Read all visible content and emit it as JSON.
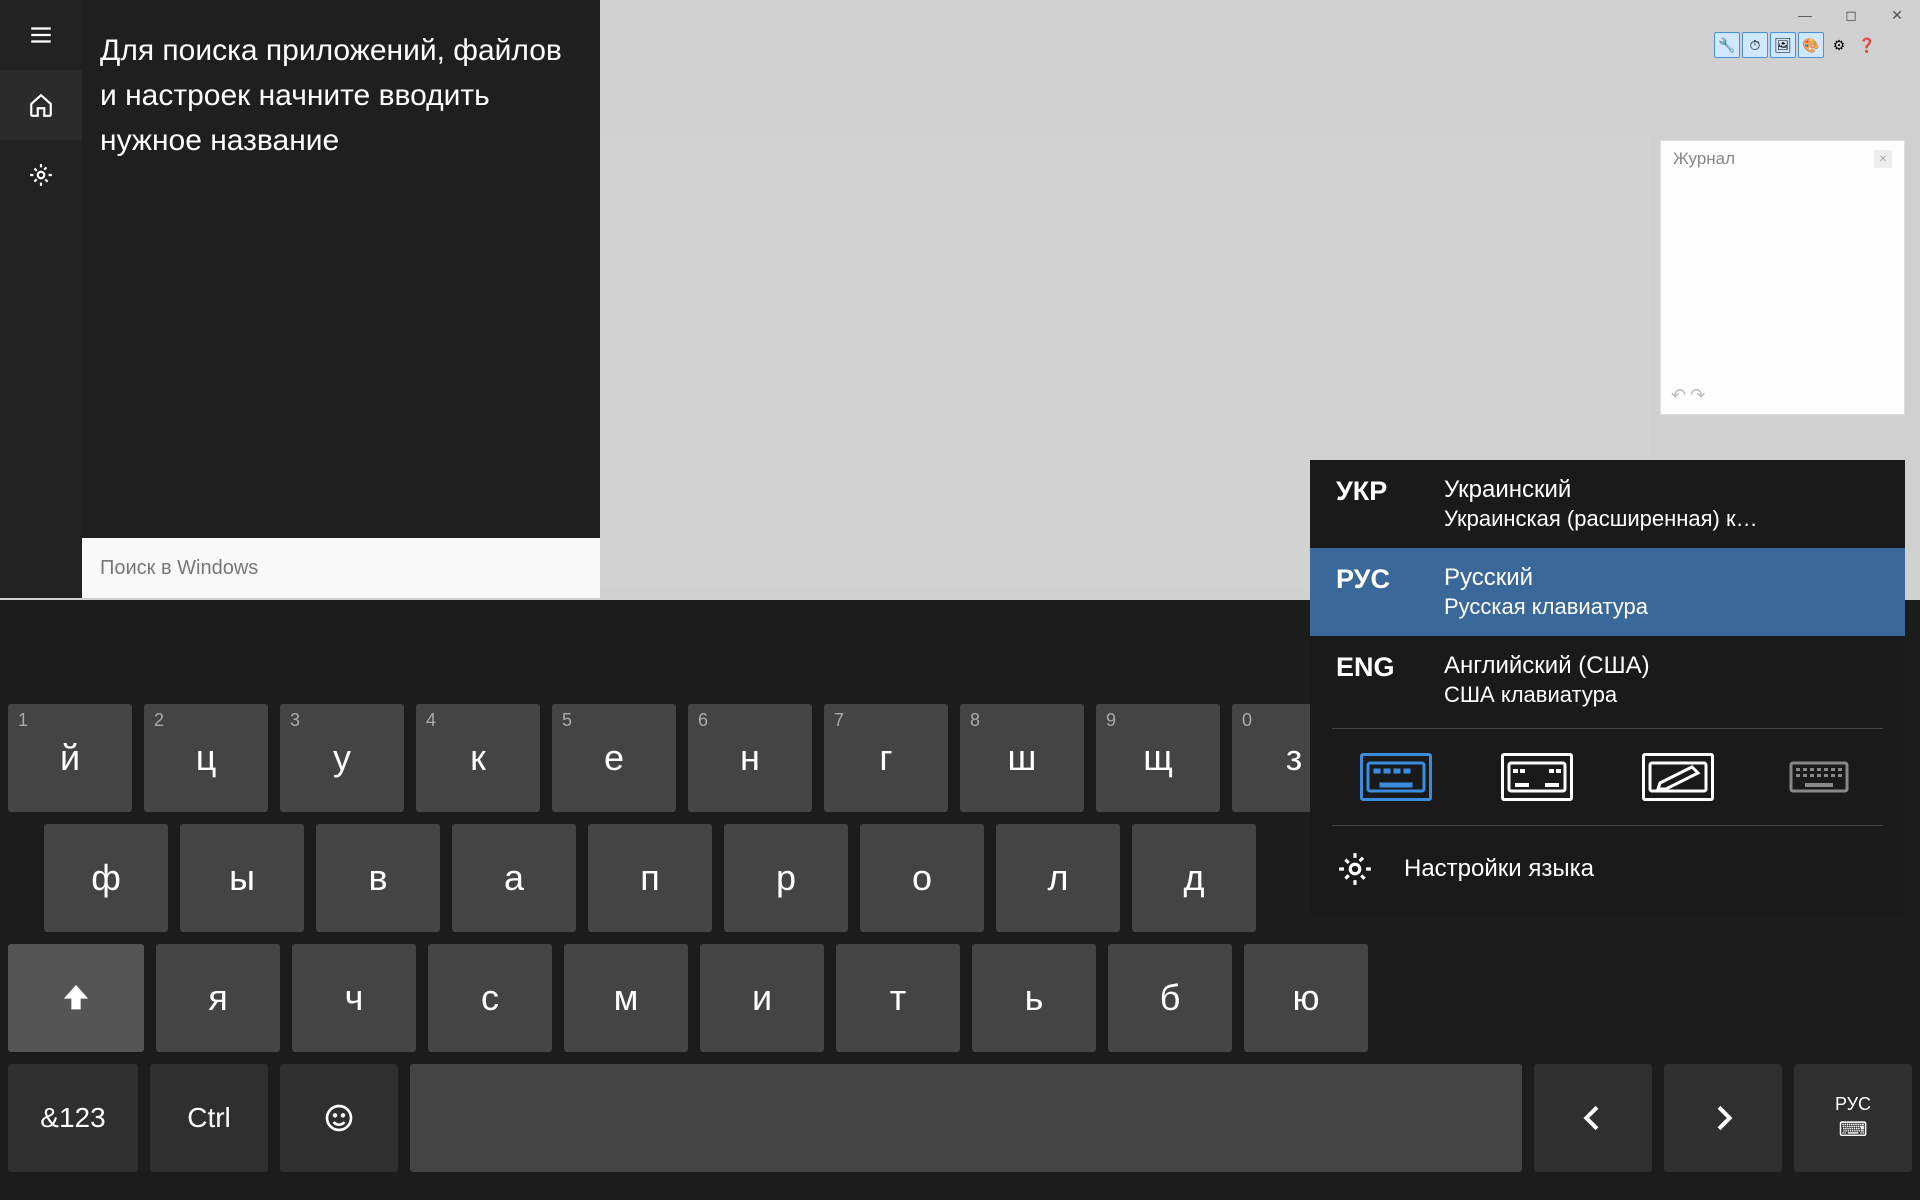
{
  "window": {
    "minimize": "—",
    "maximize": "◻",
    "close": "✕"
  },
  "toolbar": {
    "icons": [
      "🔧",
      "⏱",
      "🖼",
      "🎨",
      "⚙",
      "❓"
    ]
  },
  "history": {
    "title": "Журнал",
    "undo": "↶",
    "redo": "↷"
  },
  "start": {
    "hint": "Для поиска приложений, файлов и настроек начните вводить нужное название",
    "search_placeholder": "Поиск в Windows"
  },
  "lang_menu": {
    "items": [
      {
        "code": "УКР",
        "name": "Украинский",
        "sub": "Украинская (расширенная) к…"
      },
      {
        "code": "РУС",
        "name": "Русский",
        "sub": "Русская клавиатура"
      },
      {
        "code": "ENG",
        "name": "Английский (США)",
        "sub": "США клавиатура"
      }
    ],
    "settings": "Настройки языка"
  },
  "keyboard": {
    "row1": [
      {
        "num": "1",
        "ch": "й"
      },
      {
        "num": "2",
        "ch": "ц"
      },
      {
        "num": "3",
        "ch": "у"
      },
      {
        "num": "4",
        "ch": "к"
      },
      {
        "num": "5",
        "ch": "е"
      },
      {
        "num": "6",
        "ch": "н"
      },
      {
        "num": "7",
        "ch": "г"
      },
      {
        "num": "8",
        "ch": "ш"
      },
      {
        "num": "9",
        "ch": "щ"
      },
      {
        "num": "0",
        "ch": "з"
      }
    ],
    "row2": [
      "ф",
      "ы",
      "в",
      "а",
      "п",
      "р",
      "о",
      "л",
      "д"
    ],
    "row3": [
      "я",
      "ч",
      "с",
      "м",
      "и",
      "т",
      "ь",
      "б",
      "ю"
    ],
    "sym": "&123",
    "ctrl": "Ctrl",
    "lang_short": "РУС"
  }
}
